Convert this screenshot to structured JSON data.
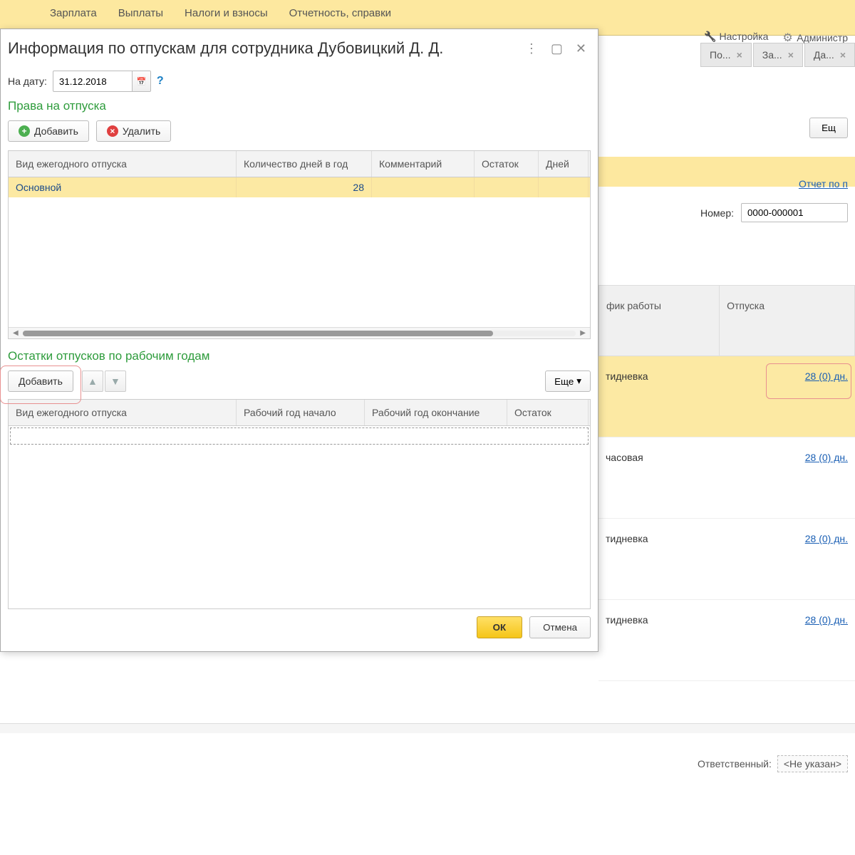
{
  "bg": {
    "toolbar": [
      "Зарплата",
      "Выплаты",
      "Налоги и взносы",
      "Отчетность, справки"
    ],
    "menu_right": [
      "Настройка",
      "Администр"
    ],
    "tabs": [
      "По...",
      "За...",
      "Да..."
    ],
    "more_btn": "Ещ",
    "report_link": "Отчет по п",
    "number_label": "Номер:",
    "number_value": "0000-000001",
    "th1": "фик работы",
    "th2": "Отпуска",
    "rows": [
      {
        "c1": "тидневка",
        "c2": "28 (0) дн."
      },
      {
        "c1": "часовая",
        "c2": "28 (0) дн."
      },
      {
        "c1": "тидневка",
        "c2": "28 (0) дн."
      },
      {
        "c1": "тидневка",
        "c2": "28 (0) дн."
      }
    ],
    "status_label": "Ответственный:",
    "status_value": "<Не указан>"
  },
  "dialog": {
    "title": "Информация по отпускам для сотрудника Дубовицкий Д. Д.",
    "date_label": "На дату:",
    "date_value": "31.12.2018",
    "section1_title": "Права на отпуска",
    "add_label": "Добавить",
    "del_label": "Удалить",
    "grid1": {
      "headers": [
        "Вид ежегодного отпуска",
        "Количество дней в год",
        "Комментарий",
        "Остаток",
        "Дней"
      ],
      "row": {
        "type": "Основной",
        "days": "28"
      }
    },
    "section2_title": "Остатки отпусков по рабочим годам",
    "add2_label": "Добавить",
    "more_label": "Еще",
    "grid2_headers": [
      "Вид ежегодного отпуска",
      "Рабочий год начало",
      "Рабочий год окончание",
      "Остаток"
    ],
    "ok_label": "ОК",
    "cancel_label": "Отмена"
  }
}
